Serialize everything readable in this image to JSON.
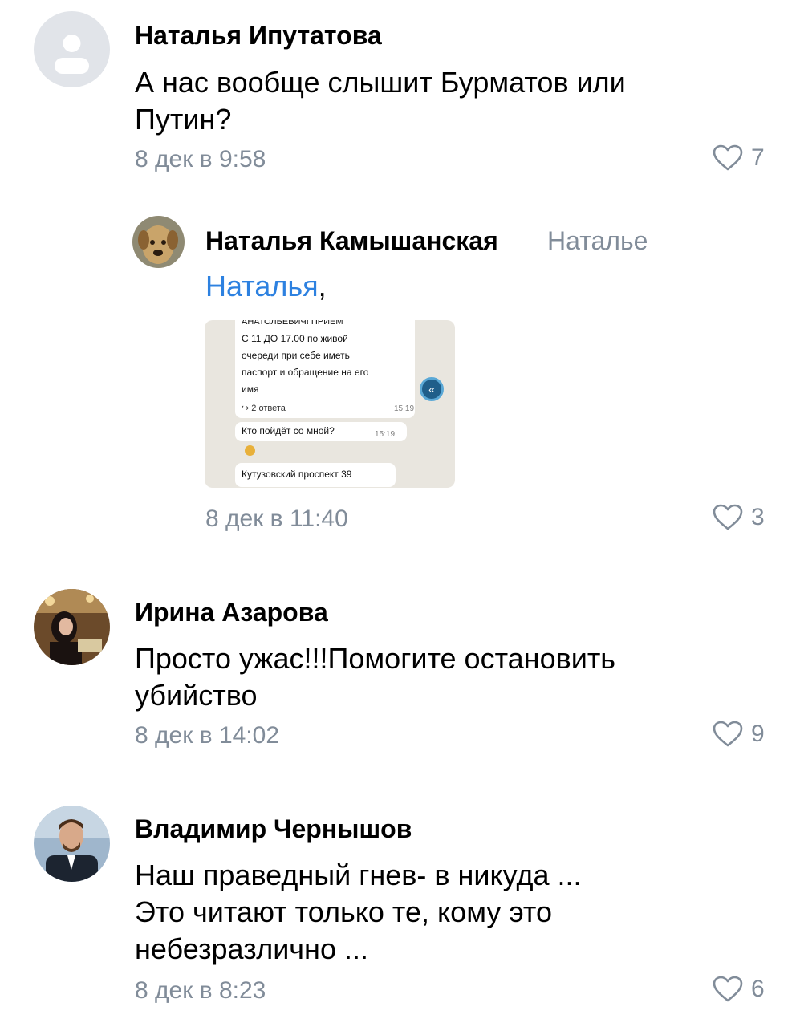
{
  "comments": [
    {
      "author": "Наталья Ипутатова",
      "text_lines": [
        "А нас вообще слышит Бурматов или",
        "Путин?"
      ],
      "time": "8 дек в 9:58",
      "likes": "7"
    },
    {
      "author": "Наталья Камышанская",
      "reply_to": "Наталье",
      "mention": "Наталья",
      "mention_suffix": ",",
      "attachment": {
        "lines": [
          "АНАТОЛЬЕВИЧ! ПРИЕМ",
          "С 11 ДО 17.00 по живой",
          "очереди при себе иметь",
          "паспорт и обращение на его",
          "имя"
        ],
        "replies": "↪ 2 ответа",
        "time1": "15:19",
        "question": "Кто пойдёт со мной?",
        "time2": "15:19",
        "address": "Кутузовский проспект 39",
        "back_icon": "«"
      },
      "time": "8 дек в 11:40",
      "likes": "3"
    },
    {
      "author": "Ирина Азарова",
      "text_lines": [
        "Просто ужас!!!Помогите остановить",
        "убийство"
      ],
      "time": "8 дек в 14:02",
      "likes": "9"
    },
    {
      "author": "Владимир Чернышов",
      "text_lines": [
        "Наш праведный гнев- в никуда ...",
        "Это читают только те, кому это",
        "небезразлично ..."
      ],
      "time": "8 дек в 8:23",
      "likes": "6"
    }
  ],
  "colors": {
    "meta": "#818c99",
    "link": "#2d81e0",
    "placeholder_avatar": "#e1e4e9"
  }
}
